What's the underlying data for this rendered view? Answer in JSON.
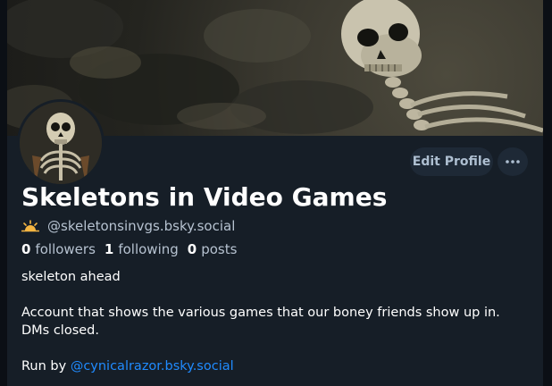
{
  "profile": {
    "display_name": "Skeletons in Video Games",
    "handle": "@skeletonsinvgs.bsky.social",
    "handle_icon": "sunrise-icon",
    "stats": {
      "followers_count": "0",
      "followers_label": "followers",
      "following_count": "1",
      "following_label": "following",
      "posts_count": "0",
      "posts_label": "posts"
    },
    "bio": {
      "line1": "skeleton ahead",
      "line2": "Account that shows the various games that our boney friends show up in. DMs closed.",
      "line3_prefix": "Run by",
      "line3_link": "@cynicalrazor.bsky.social"
    }
  },
  "actions": {
    "edit_profile_label": "Edit Profile",
    "more_icon": "ellipsis-icon"
  },
  "colors": {
    "background": "#161e27",
    "button_bg": "#1e2936",
    "link": "#208bfe",
    "muted_text": "#b6c2d0"
  }
}
